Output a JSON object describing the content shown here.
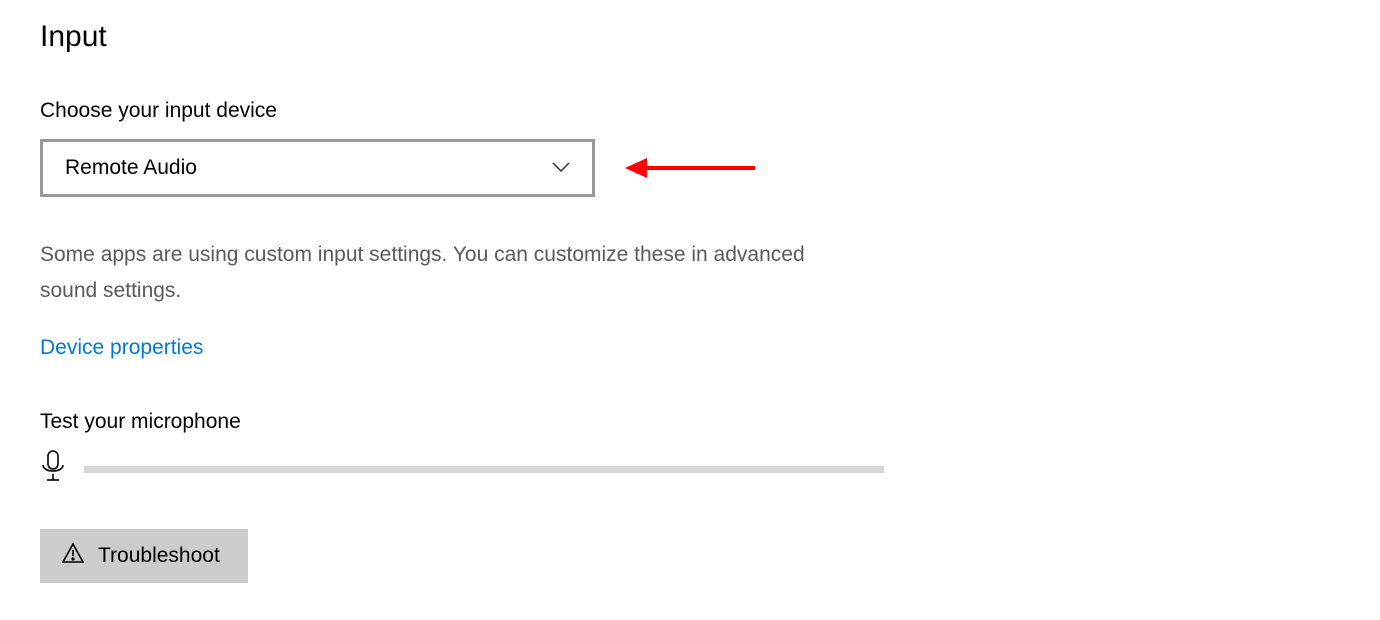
{
  "input": {
    "section_title": "Input",
    "choose_label": "Choose your input device",
    "dropdown_value": "Remote Audio",
    "info_text": "Some apps are using custom input settings. You can customize these in advanced sound settings.",
    "device_properties_link": "Device properties",
    "test_mic_label": "Test your microphone",
    "troubleshoot_label": "Troubleshoot"
  }
}
